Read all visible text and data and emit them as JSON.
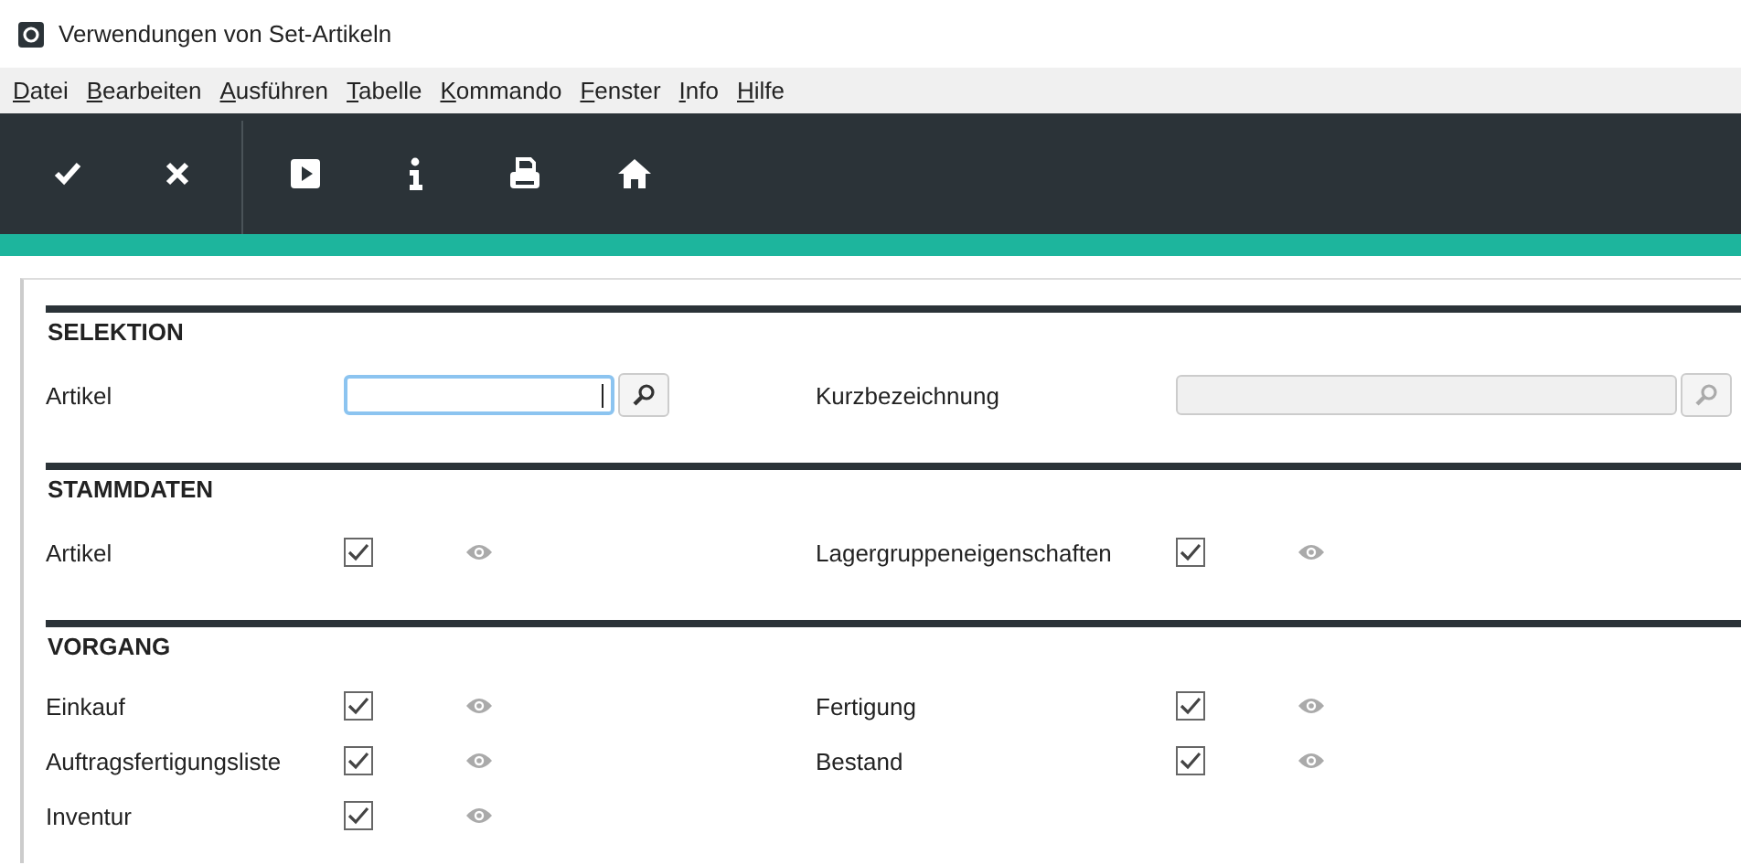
{
  "window": {
    "title": "Verwendungen von Set-Artikeln"
  },
  "menu": [
    "Datei",
    "Bearbeiten",
    "Ausführen",
    "Tabelle",
    "Kommando",
    "Fenster",
    "Info",
    "Hilfe"
  ],
  "toolbar": [
    {
      "kind": "check"
    },
    {
      "kind": "close"
    },
    {
      "kind": "separator"
    },
    {
      "kind": "play"
    },
    {
      "kind": "info"
    },
    {
      "kind": "print"
    },
    {
      "kind": "home"
    }
  ],
  "sections": [
    {
      "heading": "SELEKTION",
      "rows": [
        [
          {
            "kind": "lookup",
            "label": "Artikel",
            "focused": true,
            "disabled": false
          },
          {
            "kind": "lookup",
            "label": "Kurzbezeichnung",
            "focused": false,
            "disabled": true
          }
        ]
      ]
    },
    {
      "heading": "STAMMDATEN",
      "rows": [
        [
          {
            "kind": "checkbox",
            "label": "Artikel",
            "checked": true
          },
          {
            "kind": "checkbox",
            "label": "Lagergruppeneigenschaften",
            "checked": true
          }
        ]
      ]
    },
    {
      "heading": "VORGANG",
      "rows": [
        [
          {
            "kind": "checkbox",
            "label": "Einkauf",
            "checked": true
          },
          {
            "kind": "checkbox",
            "label": "Fertigung",
            "checked": true
          }
        ],
        [
          {
            "kind": "checkbox",
            "label": "Auftragsfertigungsliste",
            "checked": true
          },
          {
            "kind": "checkbox",
            "label": "Bestand",
            "checked": true
          }
        ],
        [
          {
            "kind": "checkbox",
            "label": "Inventur",
            "checked": true
          }
        ]
      ]
    }
  ]
}
